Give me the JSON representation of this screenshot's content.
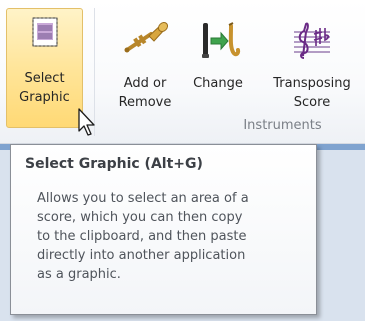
{
  "ribbon": {
    "buttons": [
      {
        "label_line1": "Select",
        "label_line2": "Graphic",
        "icon": "select-graphic-icon"
      },
      {
        "label_line1": "Add or",
        "label_line2": "Remove",
        "icon": "trumpet-icon"
      },
      {
        "label_line1": "Change",
        "label_line2": "",
        "icon": "change-instrument-icon"
      },
      {
        "label_line1": "Transposing",
        "label_line2": "Score",
        "icon": "transposing-score-icon"
      }
    ],
    "group_label": "Instruments"
  },
  "tooltip": {
    "title": "Select Graphic (Alt+G)",
    "line1": "Allows you to select an area of a",
    "line2": "score, which you can then copy",
    "line3": "to the clipboard, and then paste",
    "line4": "directly into another application",
    "line5": "as a graphic."
  },
  "colors": {
    "selected_button": "#ffe59a",
    "selected_border": "#e3c069",
    "group_label": "#7a7f87",
    "tooltip_border": "#8a8f97"
  }
}
